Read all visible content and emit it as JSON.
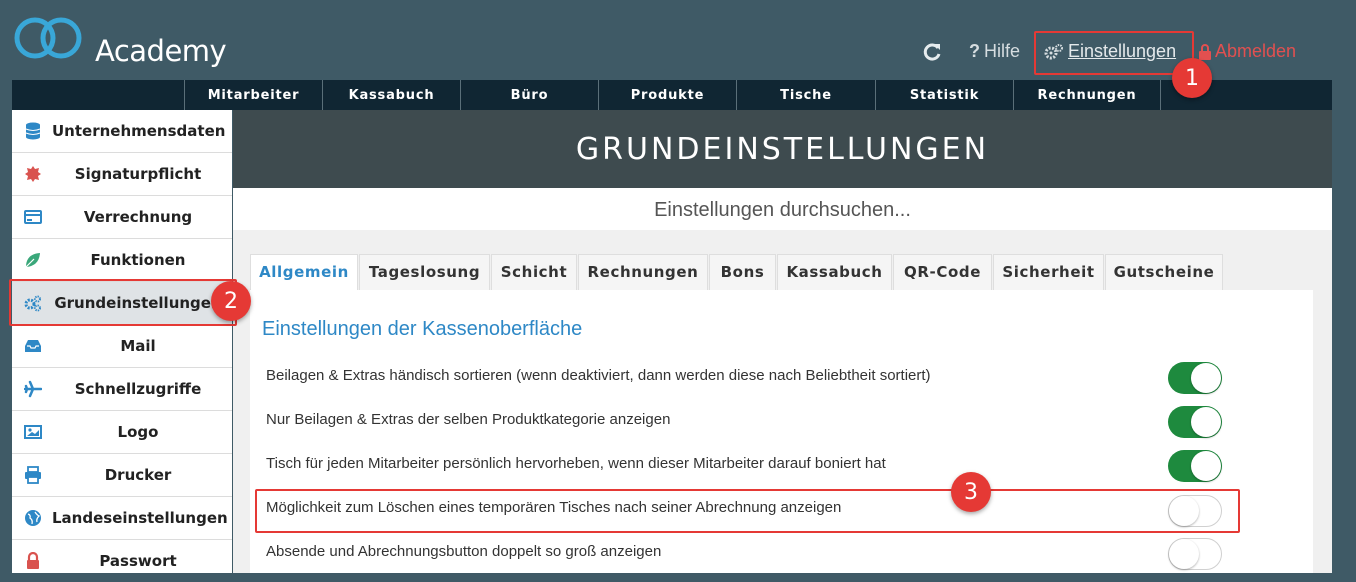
{
  "app": {
    "name": "Academy"
  },
  "header": {
    "refresh_icon": "refresh-icon",
    "help_label": "Hilfe",
    "settings_label": "Einstellungen",
    "logout_label": "Abmelden",
    "logout_color": "#e25050"
  },
  "nav": {
    "items": [
      "Mitarbeiter",
      "Kassabuch",
      "Büro",
      "Produkte",
      "Tische",
      "Statistik",
      "Rechnungen"
    ]
  },
  "sidebar": {
    "items": [
      {
        "label": "Unternehmensdaten",
        "icon": "database-icon"
      },
      {
        "label": "Signaturpflicht",
        "icon": "certificate-icon"
      },
      {
        "label": "Verrechnung",
        "icon": "credit-card-icon"
      },
      {
        "label": "Funktionen",
        "icon": "leaf-icon"
      },
      {
        "label": "Grundeinstellungen",
        "icon": "gears-icon",
        "active": true
      },
      {
        "label": "Mail",
        "icon": "inbox-icon"
      },
      {
        "label": "Schnellzugriffe",
        "icon": "plane-icon"
      },
      {
        "label": "Logo",
        "icon": "image-icon"
      },
      {
        "label": "Drucker",
        "icon": "printer-icon"
      },
      {
        "label": "Landeseinstellungen",
        "icon": "globe-icon"
      },
      {
        "label": "Passwort",
        "icon": "lock-icon"
      }
    ]
  },
  "main": {
    "title": "GRUNDEINSTELLUNGEN",
    "search_placeholder": "Einstellungen durchsuchen...",
    "tabs": [
      "Allgemein",
      "Tageslosung",
      "Schicht",
      "Rechnungen",
      "Bons",
      "Kassabuch",
      "QR-Code",
      "Sicherheit",
      "Gutscheine"
    ],
    "active_tab": "Allgemein",
    "section_title": "Einstellungen der Kassenoberfläche",
    "settings": [
      {
        "label": "Beilagen & Extras händisch sortieren (wenn deaktiviert, dann werden diese nach Beliebtheit sortiert)",
        "enabled": true
      },
      {
        "label": "Nur Beilagen & Extras der selben Produktkategorie anzeigen",
        "enabled": true
      },
      {
        "label": "Tisch für jeden Mitarbeiter persönlich hervorheben, wenn dieser Mitarbeiter darauf boniert hat",
        "enabled": true
      },
      {
        "label": "Möglichkeit zum Löschen eines temporären Tisches nach seiner Abrechnung anzeigen",
        "enabled": false
      },
      {
        "label": "Absende und Abrechnungsbutton doppelt so groß anzeigen",
        "enabled": false
      }
    ]
  },
  "annotations": {
    "badges": [
      "1",
      "2",
      "3"
    ],
    "color": "#e53935"
  },
  "colors": {
    "accent": "#2e88c6",
    "toggle_on": "#1e8a3e",
    "header_bg": "#3f5a66",
    "navbar_bg": "#102633"
  }
}
